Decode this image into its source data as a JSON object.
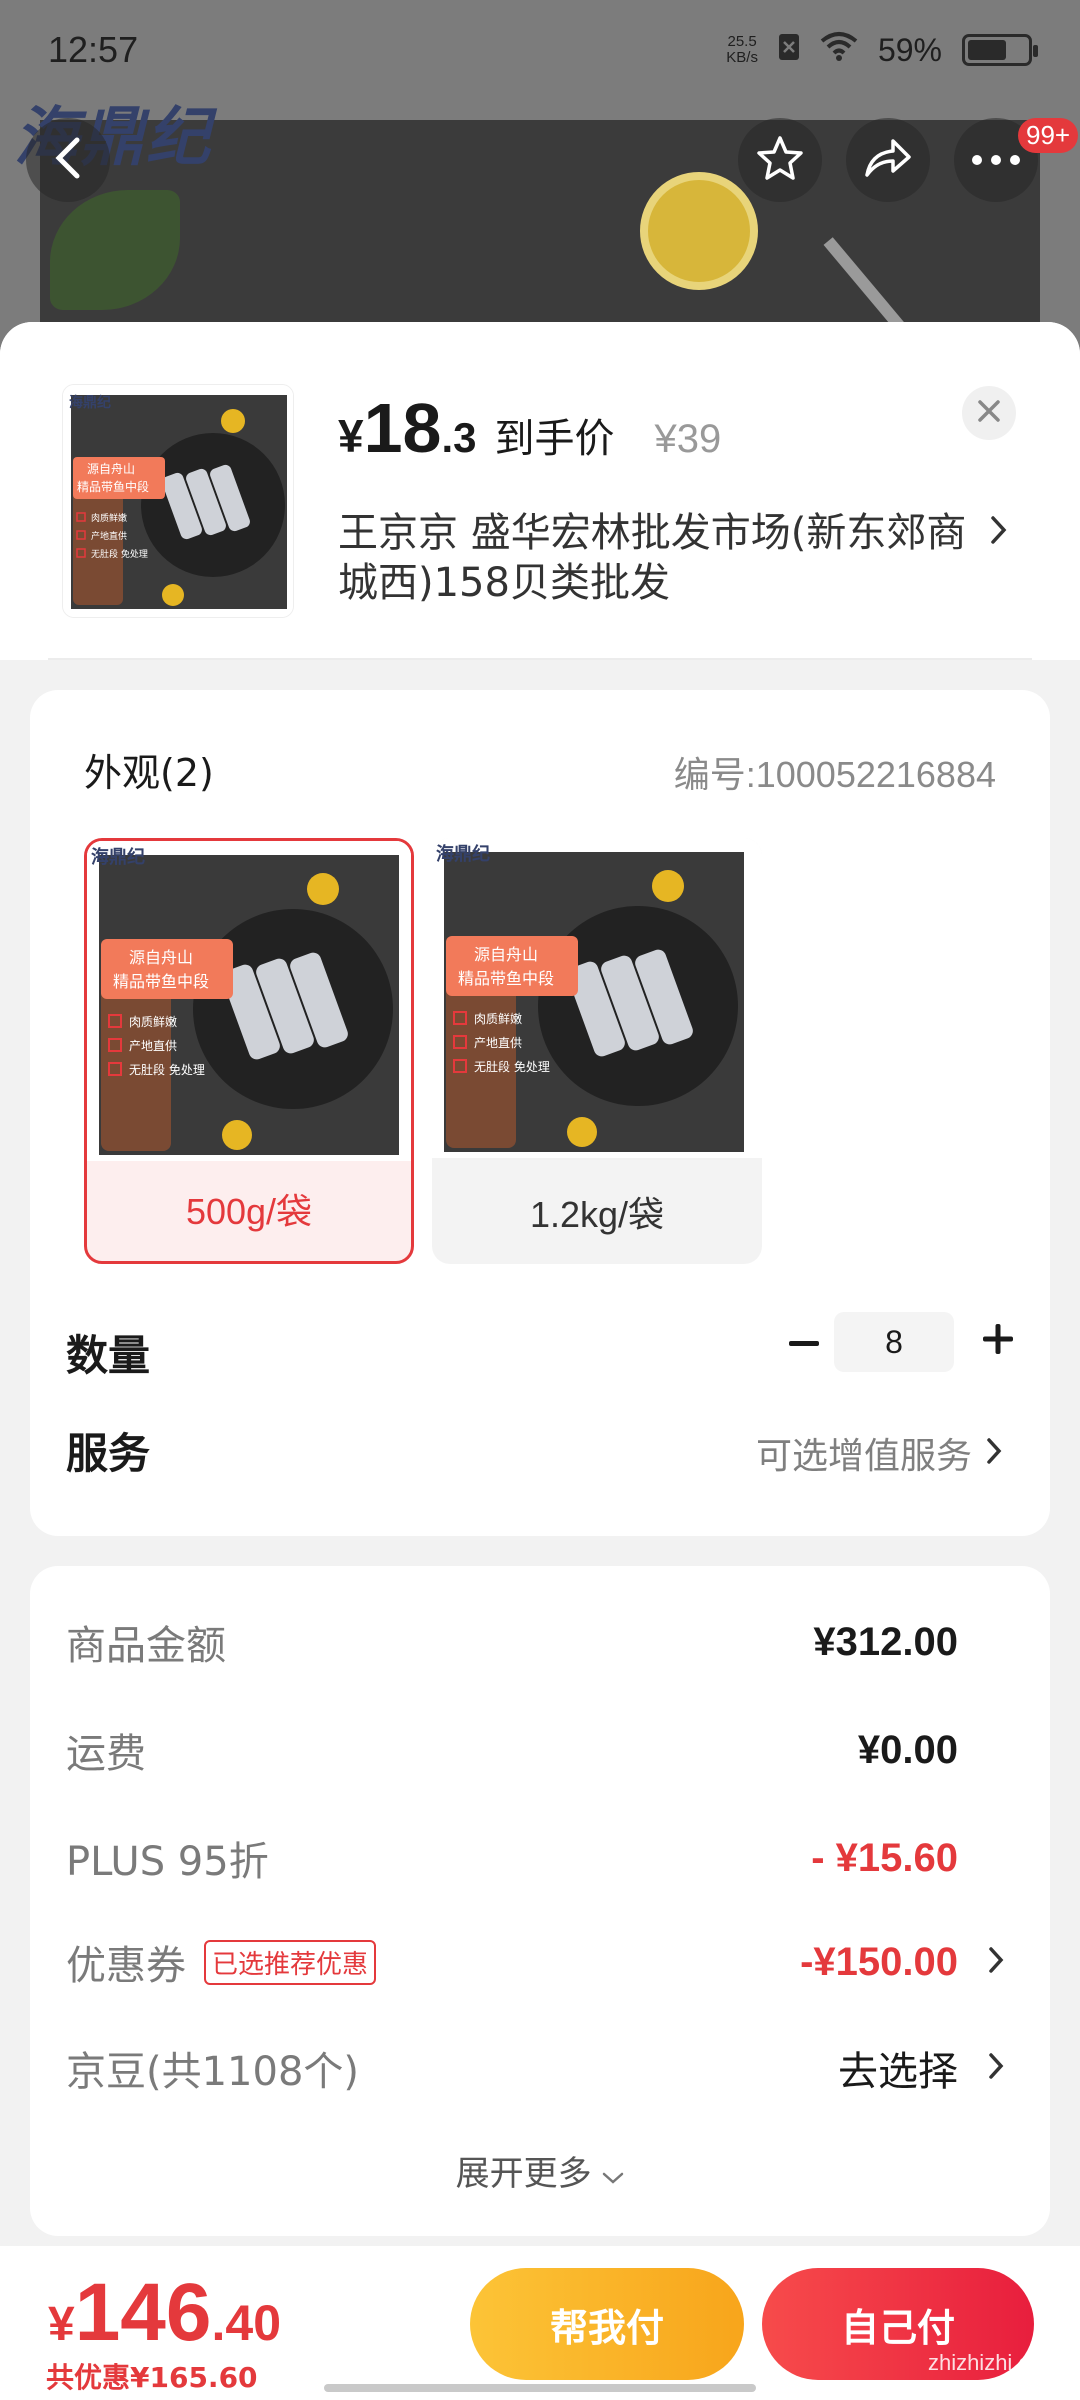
{
  "status_bar": {
    "time": "12:57",
    "net_speed_value": "25.5",
    "net_speed_unit": "KB/s",
    "battery": "59%"
  },
  "background_page": {
    "brand": "海鼎纪",
    "badge": "99+"
  },
  "sheet": {
    "price": {
      "yen": "¥",
      "integer": "18",
      "decimal": ".3",
      "label": "到手价",
      "original": "¥39"
    },
    "store": "王京京  盛华宏林批发市场(新东郊商城西)158贝类批发"
  },
  "spec": {
    "title": "外观(2)",
    "code": "编号:100052216884",
    "variants": [
      {
        "label": "500g/袋",
        "selected": true
      },
      {
        "label": "1.2kg/袋",
        "selected": false
      }
    ],
    "image_text": {
      "brand": "海鼎纪",
      "headline_1": "源自舟山",
      "headline_2": "精品带鱼中段",
      "features": [
        "肉质鲜嫩",
        "产地直供",
        "无肚段 免处理"
      ]
    }
  },
  "quantity": {
    "label": "数量",
    "value": "8"
  },
  "service": {
    "label": "服务",
    "hint": "可选增值服务"
  },
  "fees": {
    "goods_label": "商品金额",
    "goods_value": "¥312.00",
    "shipping_label": "运费",
    "shipping_value": "¥0.00",
    "plus_label": "PLUS 95折",
    "plus_value": "- ¥15.60",
    "coupon_label": "优惠券",
    "coupon_tag": "已选推荐优惠",
    "coupon_value": "-¥150.00",
    "beans_label": "京豆(共1108个)",
    "beans_value": "去选择",
    "expand": "展开更多"
  },
  "bottom": {
    "total_yen": "¥",
    "total_int": "146",
    "total_dec": ".40",
    "saving": "共优惠¥165.60",
    "help_pay": "帮我付",
    "self_pay": "自己付",
    "watermark": "zhizhizhi.com"
  },
  "colors": {
    "accent": "#e4393c",
    "help_button": "#f8a51b",
    "self_button": "#e81e3d"
  }
}
